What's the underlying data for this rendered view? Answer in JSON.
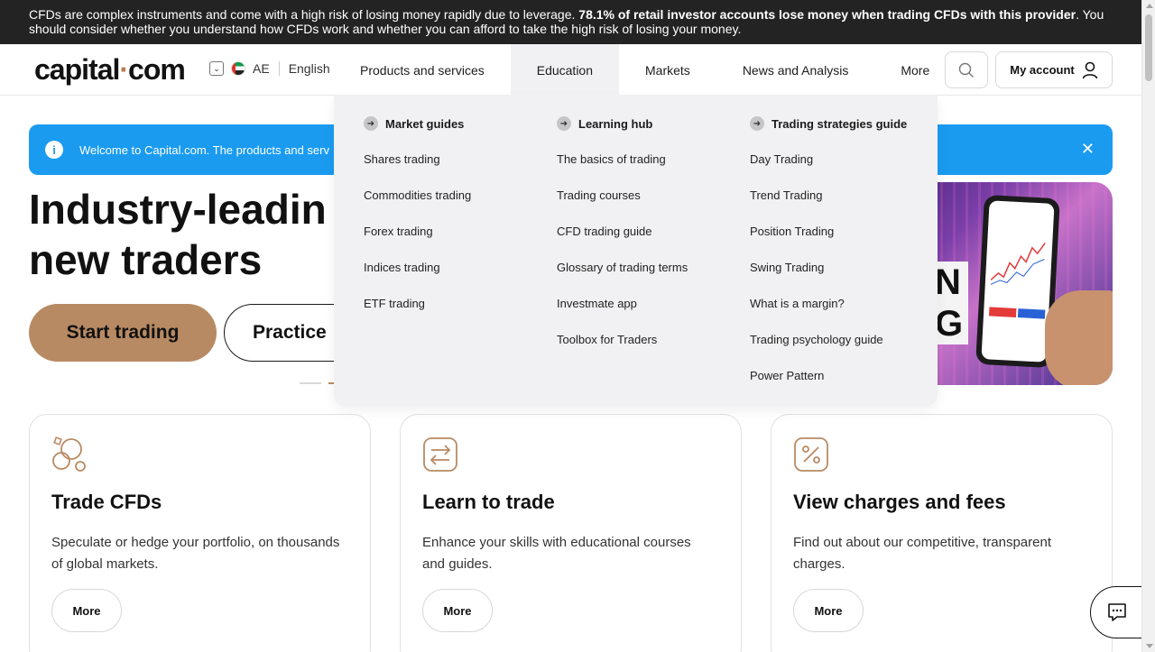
{
  "risk_warning": {
    "text_before": "CFDs are complex instruments and come with a high risk of losing money rapidly due to leverage. ",
    "bold": "78.1% of retail investor accounts lose money when trading CFDs with this provider",
    "text_after": ". You should consider whether you understand how CFDs work and whether you can afford to take the high risk of losing your money."
  },
  "header": {
    "logo_left": "capital",
    "logo_dot": "·",
    "logo_right": "com",
    "region": "AE",
    "language": "English",
    "nav": [
      {
        "label": "Products and services"
      },
      {
        "label": "Education"
      },
      {
        "label": "Markets"
      },
      {
        "label": "News and Analysis"
      },
      {
        "label": "More"
      }
    ],
    "account_label": "My account"
  },
  "notice": {
    "text": "Welcome to Capital.com. The products and serv"
  },
  "hero": {
    "title_line1": "Industry-leadin",
    "title_line2": "new traders",
    "start_label": "Start trading",
    "practice_label": "Practice",
    "image_word": "N\nG"
  },
  "cards": [
    {
      "title": "Trade CFDs",
      "text": "Speculate or hedge your portfolio, on thousands of global markets.",
      "more": "More",
      "icon": "coins-icon"
    },
    {
      "title": "Learn to trade",
      "text": "Enhance your skills with educational courses and guides.",
      "more": "More",
      "icon": "exchange-arrows-icon"
    },
    {
      "title": "View charges and fees",
      "text": "Find out about our competitive, transparent charges.",
      "more": "More",
      "icon": "percent-icon"
    }
  ],
  "dropdown": {
    "columns": [
      {
        "heading": "Market guides",
        "links": [
          "Shares trading",
          "Commodities trading",
          "Forex trading",
          "Indices trading",
          "ETF trading"
        ]
      },
      {
        "heading": "Learning hub",
        "links": [
          "The basics of trading",
          "Trading courses",
          "CFD trading guide",
          "Glossary of trading terms",
          "Investmate app",
          "Toolbox for Traders"
        ]
      },
      {
        "heading": "Trading strategies guide",
        "links": [
          "Day Trading",
          "Trend Trading",
          "Position Trading",
          "Swing Trading",
          "What is a margin?",
          "Trading psychology guide",
          "Power Pattern"
        ]
      }
    ]
  },
  "colors": {
    "accent": "#b88a63",
    "notice_blue": "#1a9bf0",
    "risk_bar": "#232323",
    "dropdown_bg": "#f1f1f3"
  }
}
